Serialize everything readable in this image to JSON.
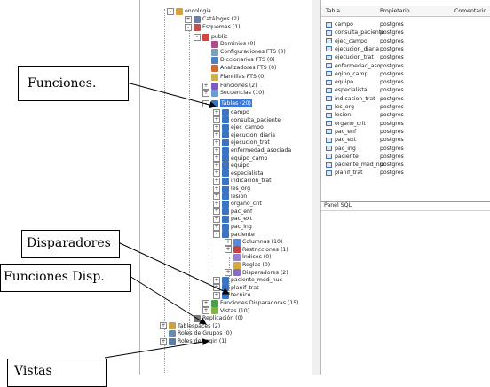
{
  "tree": {
    "nodes": [
      {
        "id": "oncologia",
        "label": "oncologia",
        "toggle": "-",
        "icon": "db"
      },
      {
        "id": "catalogos",
        "label": "Catálogos (2)",
        "toggle": "+",
        "icon": "cat"
      },
      {
        "id": "esquemas",
        "label": "Esquemas (1)",
        "toggle": "-",
        "icon": "sch"
      },
      {
        "id": "public",
        "label": "public",
        "toggle": "-",
        "icon": "pub"
      },
      {
        "id": "dominios",
        "label": "Dominios (0)",
        "toggle": "",
        "icon": "dom"
      },
      {
        "id": "configfts",
        "label": "Configuraciones FTS (0)",
        "toggle": "",
        "icon": "cfg"
      },
      {
        "id": "diccfts",
        "label": "Diccionarios FTS (0)",
        "toggle": "",
        "icon": "dic"
      },
      {
        "id": "analfts",
        "label": "Analizadores FTS (0)",
        "toggle": "",
        "icon": "ana"
      },
      {
        "id": "plantfts",
        "label": "Plantillas FTS (0)",
        "toggle": "",
        "icon": "pla"
      },
      {
        "id": "funciones",
        "label": "Funciones (2)",
        "toggle": "+",
        "icon": "fun"
      },
      {
        "id": "secuencias",
        "label": "Secuencias (10)",
        "toggle": "+",
        "icon": "sec"
      },
      {
        "id": "tablas",
        "label": "Tablas (20)",
        "toggle": "-",
        "icon": "tbl",
        "selected": true
      },
      {
        "id": "t1",
        "label": "campo",
        "toggle": "+",
        "icon": "tbl"
      },
      {
        "id": "t2",
        "label": "consulta_paciente",
        "toggle": "+",
        "icon": "tbl"
      },
      {
        "id": "t3",
        "label": "ejec_campo",
        "toggle": "+",
        "icon": "tbl"
      },
      {
        "id": "t4",
        "label": "ejecucion_diaria",
        "toggle": "+",
        "icon": "tbl"
      },
      {
        "id": "t5",
        "label": "ejecucion_trat",
        "toggle": "+",
        "icon": "tbl"
      },
      {
        "id": "t6",
        "label": "enfermedad_asociada",
        "toggle": "+",
        "icon": "tbl"
      },
      {
        "id": "t7",
        "label": "equipo_camp",
        "toggle": "+",
        "icon": "tbl"
      },
      {
        "id": "t8",
        "label": "equipo",
        "toggle": "+",
        "icon": "tbl"
      },
      {
        "id": "t9",
        "label": "especialista",
        "toggle": "+",
        "icon": "tbl"
      },
      {
        "id": "t10",
        "label": "indicacion_trat",
        "toggle": "+",
        "icon": "tbl"
      },
      {
        "id": "t11",
        "label": "les_org",
        "toggle": "+",
        "icon": "tbl"
      },
      {
        "id": "t12",
        "label": "lesion",
        "toggle": "+",
        "icon": "tbl"
      },
      {
        "id": "t13",
        "label": "organo_crit",
        "toggle": "+",
        "icon": "tbl"
      },
      {
        "id": "t14",
        "label": "pac_enf",
        "toggle": "+",
        "icon": "tbl"
      },
      {
        "id": "t15",
        "label": "pac_ext",
        "toggle": "+",
        "icon": "tbl"
      },
      {
        "id": "t16",
        "label": "pac_ing",
        "toggle": "+",
        "icon": "tbl"
      },
      {
        "id": "t17",
        "label": "paciente",
        "toggle": "-",
        "icon": "tbl"
      },
      {
        "id": "columnas",
        "label": "Columnas (10)",
        "toggle": "+",
        "icon": "col"
      },
      {
        "id": "restricciones",
        "label": "Restricciones (1)",
        "toggle": "+",
        "icon": "res"
      },
      {
        "id": "indices",
        "label": "Índices (0)",
        "toggle": "",
        "icon": "idx"
      },
      {
        "id": "reglas",
        "label": "Reglas (0)",
        "toggle": "",
        "icon": "reg"
      },
      {
        "id": "disparadores",
        "label": "Disparadores (2)",
        "toggle": "+",
        "icon": "dis"
      },
      {
        "id": "t18",
        "label": "paciente_med_nuc",
        "toggle": "+",
        "icon": "tbl"
      },
      {
        "id": "t19",
        "label": "planif_trat",
        "toggle": "+",
        "icon": "tbl"
      },
      {
        "id": "t20",
        "label": "tecnico",
        "toggle": "+",
        "icon": "tbl"
      },
      {
        "id": "funcdisp",
        "label": "Funciones Disparadoras (15)",
        "toggle": "+",
        "icon": "fdi"
      },
      {
        "id": "vistas",
        "label": "Vistas (10)",
        "toggle": "+",
        "icon": "vis"
      },
      {
        "id": "replicacion",
        "label": "Replicación (0)",
        "toggle": "",
        "icon": "rep"
      },
      {
        "id": "tablespaces",
        "label": "Tablespaces (2)",
        "toggle": "+",
        "icon": "tsp"
      },
      {
        "id": "rolesgrupos",
        "label": "Roles de Grupos (0)",
        "toggle": "",
        "icon": "rgr"
      },
      {
        "id": "roleslogin",
        "label": "Roles de Login (1)",
        "toggle": "+",
        "icon": "rlo"
      }
    ]
  },
  "grid": {
    "headers": {
      "tabla": "Tabla",
      "propietario": "Propietario",
      "comentario": "Comentario"
    },
    "rows": [
      {
        "name": "campo",
        "owner": "postgres"
      },
      {
        "name": "consulta_paciente",
        "owner": "postgres"
      },
      {
        "name": "ejec_campo",
        "owner": "postgres"
      },
      {
        "name": "ejecucion_diaria",
        "owner": "postgres"
      },
      {
        "name": "ejecucion_trat",
        "owner": "postgres"
      },
      {
        "name": "enfermedad_aso...",
        "owner": "postgres"
      },
      {
        "name": "eqipo_camp",
        "owner": "postgres"
      },
      {
        "name": "equipo",
        "owner": "postgres"
      },
      {
        "name": "especialista",
        "owner": "postgres"
      },
      {
        "name": "indicacion_trat",
        "owner": "postgres"
      },
      {
        "name": "les_org",
        "owner": "postgres"
      },
      {
        "name": "lesion",
        "owner": "postgres"
      },
      {
        "name": "organo_crit",
        "owner": "postgres"
      },
      {
        "name": "pac_enf",
        "owner": "postgres"
      },
      {
        "name": "pac_ext",
        "owner": "postgres"
      },
      {
        "name": "pac_ing",
        "owner": "postgres"
      },
      {
        "name": "paciente",
        "owner": "postgres"
      },
      {
        "name": "paciente_med_nuc",
        "owner": "postgres"
      },
      {
        "name": "planif_trat",
        "owner": "postgres"
      }
    ]
  },
  "sql_panel": {
    "title": "Panel SQL"
  },
  "callouts": {
    "funciones": "Funciones.",
    "disparadores": "Disparadores",
    "funciones_disp": "Funciones Disp.",
    "vistas": "Vistas"
  },
  "icon_colors": {
    "db": "#d8a23a",
    "cat": "#6f7fa8",
    "sch": "#c0504d",
    "pub": "#d0473f",
    "dom": "#b04a8a",
    "cfg": "#7f9db9",
    "dic": "#4f7fbf",
    "ana": "#d36b2e",
    "pla": "#c9b24a",
    "fun": "#7a5cc4",
    "sec": "#6c9bd2",
    "tbl": "#3a74c4",
    "col": "#5a8ad6",
    "res": "#c94040",
    "idx": "#9a7fd0",
    "reg": "#d4a83c",
    "dis": "#8a6bc9",
    "fdi": "#4aa04a",
    "vis": "#7bb843",
    "rep": "#7a7a7a",
    "tsp": "#c8a046",
    "rgr": "#6a8ab0",
    "rlo": "#5c7aa6"
  }
}
